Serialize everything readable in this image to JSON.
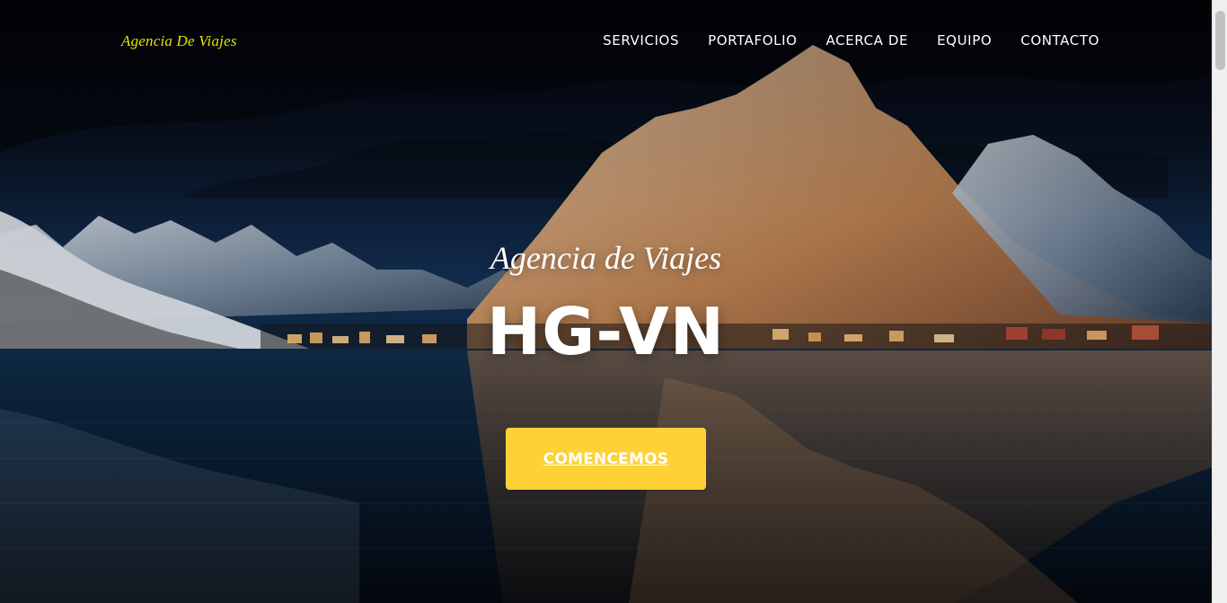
{
  "navbar": {
    "brand": "Agencia De Viajes",
    "links": [
      "SERVICIOS",
      "PORTAFOLIO",
      "ACERCA DE",
      "EQUIPO",
      "CONTACTO"
    ]
  },
  "masthead": {
    "subheading": "Agencia de Viajes",
    "heading": "HG-VN",
    "cta_label": "COMENCEMOS"
  },
  "theme": {
    "brand_color": "#e7e200",
    "cta_color": "#fed136"
  }
}
